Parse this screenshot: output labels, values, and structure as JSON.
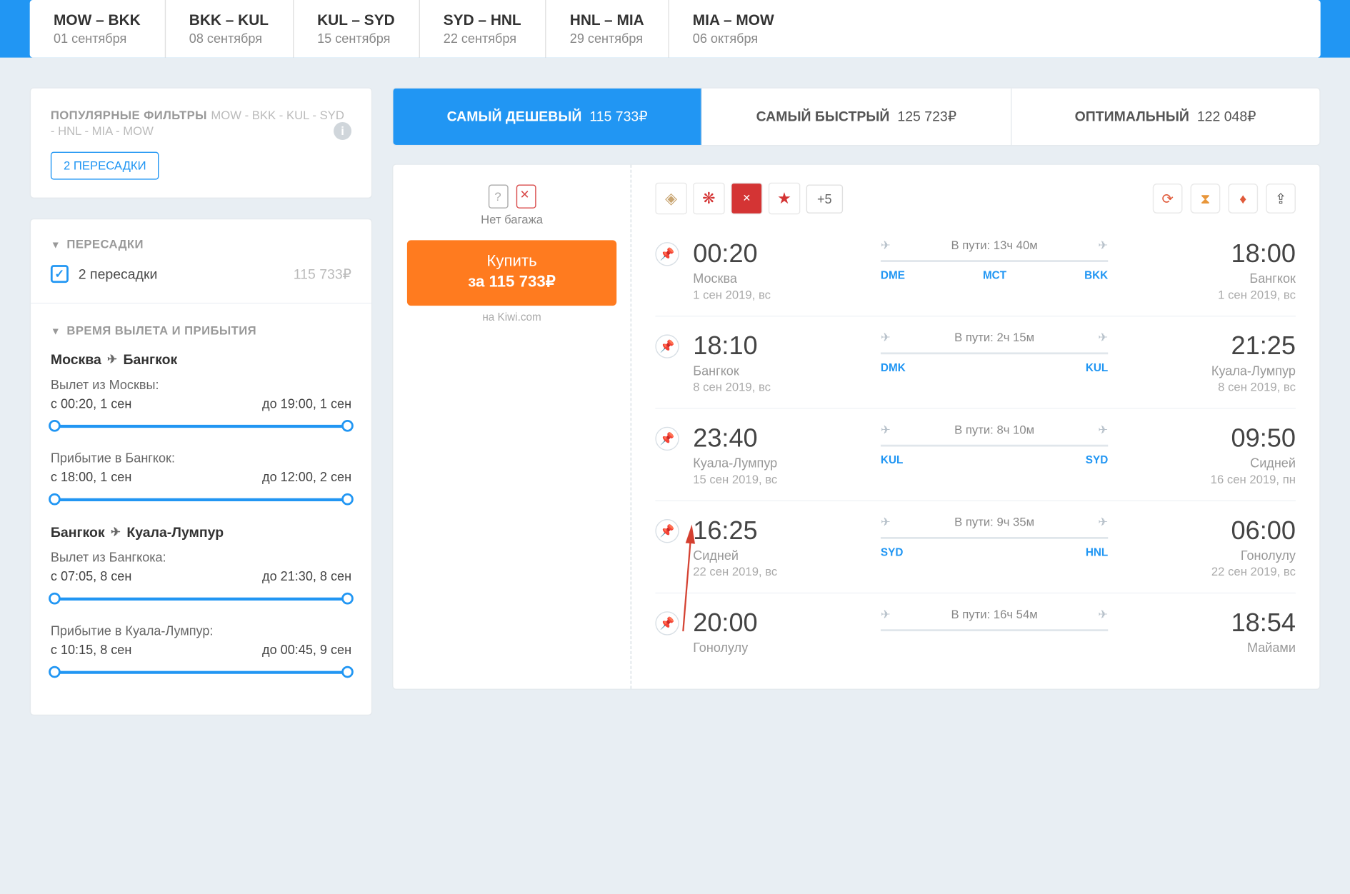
{
  "route": [
    {
      "code": "MOW – BKK",
      "date": "01 сентября"
    },
    {
      "code": "BKK – KUL",
      "date": "08 сентября"
    },
    {
      "code": "KUL – SYD",
      "date": "15 сентября"
    },
    {
      "code": "SYD – HNL",
      "date": "22 сентября"
    },
    {
      "code": "HNL – MIA",
      "date": "29 сентября"
    },
    {
      "code": "MIA – MOW",
      "date": "06 октября"
    }
  ],
  "popular": {
    "title": "ПОПУЛЯРНЫЕ ФИЛЬТРЫ",
    "sub": "MOW - BKK - KUL - SYD - HNL - MIA - MOW",
    "chip": "2 ПЕРЕСАДКИ"
  },
  "transfers": {
    "title": "ПЕРЕСАДКИ",
    "item": "2 пересадки",
    "price": "115 733₽"
  },
  "timefilter": {
    "title": "ВРЕМЯ ВЫЛЕТА И ПРИБЫТИЯ",
    "legs": [
      {
        "from": "Москва",
        "to": "Бангкок",
        "dep_label": "Вылет из Москвы:",
        "dep_from": "с 00:20, 1 сен",
        "dep_to": "до 19:00, 1 сен",
        "arr_label": "Прибытие в Бангкок:",
        "arr_from": "с 18:00, 1 сен",
        "arr_to": "до 12:00, 2 сен"
      },
      {
        "from": "Бангкок",
        "to": "Куала-Лумпур",
        "dep_label": "Вылет из Бангкока:",
        "dep_from": "с 07:05, 8 сен",
        "dep_to": "до 21:30, 8 сен",
        "arr_label": "Прибытие в Куала-Лумпур:",
        "arr_from": "с 10:15, 8 сен",
        "arr_to": "до 00:45, 9 сен"
      }
    ]
  },
  "tabs": [
    {
      "label": "САМЫЙ ДЕШЕВЫЙ",
      "price": "115 733₽",
      "active": true
    },
    {
      "label": "САМЫЙ БЫСТРЫЙ",
      "price": "125 723₽",
      "active": false
    },
    {
      "label": "ОПТИМАЛЬНЫЙ",
      "price": "122 048₽",
      "active": false
    }
  ],
  "ticket": {
    "nobag": "Нет багажа",
    "buy_line1": "Купить",
    "buy_line2": "за 115 733₽",
    "agent": "на Kiwi.com",
    "plus": "+5",
    "segments": [
      {
        "dep_time": "00:20",
        "dep_city": "Москва",
        "dep_date": "1 сен 2019, вс",
        "dur": "В пути: 13ч 40м",
        "from_code": "DME",
        "mid_code": "MCT",
        "to_code": "BKK",
        "arr_time": "18:00",
        "arr_city": "Бангкок",
        "arr_date": "1 сен 2019, вс"
      },
      {
        "dep_time": "18:10",
        "dep_city": "Бангкок",
        "dep_date": "8 сен 2019, вс",
        "dur": "В пути: 2ч 15м",
        "from_code": "DMK",
        "mid_code": "",
        "to_code": "KUL",
        "arr_time": "21:25",
        "arr_city": "Куала-Лумпур",
        "arr_date": "8 сен 2019, вс"
      },
      {
        "dep_time": "23:40",
        "dep_city": "Куала-Лумпур",
        "dep_date": "15 сен 2019, вс",
        "dur": "В пути: 8ч 10м",
        "from_code": "KUL",
        "mid_code": "",
        "to_code": "SYD",
        "arr_time": "09:50",
        "arr_city": "Сидней",
        "arr_date": "16 сен 2019, пн"
      },
      {
        "dep_time": "16:25",
        "dep_city": "Сидней",
        "dep_date": "22 сен 2019, вс",
        "dur": "В пути: 9ч 35м",
        "from_code": "SYD",
        "mid_code": "",
        "to_code": "HNL",
        "arr_time": "06:00",
        "arr_city": "Гонолулу",
        "arr_date": "22 сен 2019, вс"
      },
      {
        "dep_time": "20:00",
        "dep_city": "Гонолулу",
        "dep_date": "",
        "dur": "В пути: 16ч 54м",
        "from_code": "",
        "mid_code": "",
        "to_code": "",
        "arr_time": "18:54",
        "arr_city": "Майами",
        "arr_date": ""
      }
    ]
  }
}
